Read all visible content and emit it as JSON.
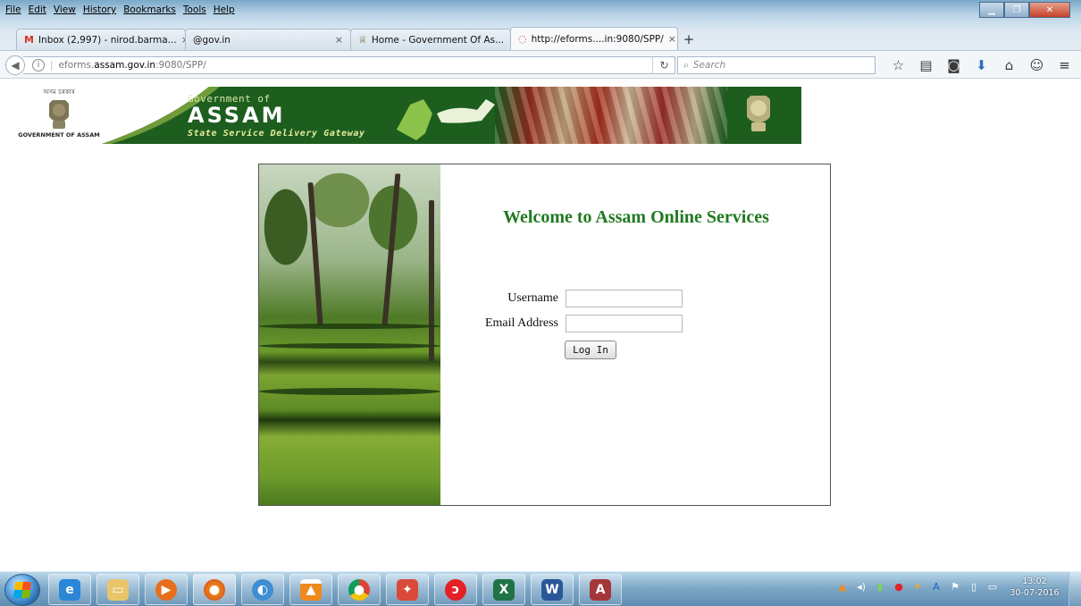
{
  "menubar": {
    "items": [
      "File",
      "Edit",
      "View",
      "History",
      "Bookmarks",
      "Tools",
      "Help"
    ]
  },
  "tabs": [
    {
      "label": "Inbox (2,997) - nirod.barma...",
      "icon": "gmail-icon"
    },
    {
      "label": "@gov.in",
      "icon": ""
    },
    {
      "label": "Home - Government Of As...",
      "icon": "govt-icon"
    },
    {
      "label": "http://eforms....in:9080/SPP/",
      "icon": "loading-icon"
    }
  ],
  "navbar": {
    "url_prefix": "eforms.",
    "url_host": "assam.gov.in",
    "url_suffix": ":9080/SPP/",
    "search_placeholder": "Search"
  },
  "banner": {
    "left_caption_assamese": "অসম চৰকাৰ",
    "left_caption": "GOVERNMENT OF ASSAM",
    "line1": "Government of",
    "line2": "ASSAM",
    "line3": "State Service Delivery Gateway"
  },
  "login": {
    "welcome": "Welcome to Assam Online Services",
    "username_label": "Username",
    "email_label": "Email Address",
    "username_value": "",
    "email_value": "",
    "login_button": "Log In"
  },
  "taskbar": {
    "apps": [
      "internet-explorer",
      "file-explorer",
      "media-player",
      "firefox",
      "windows-media-center",
      "vlc",
      "chrome",
      "app-red",
      "airtel",
      "excel",
      "word",
      "access"
    ],
    "clock_time": "13:02",
    "clock_date": "30-07-2016"
  }
}
